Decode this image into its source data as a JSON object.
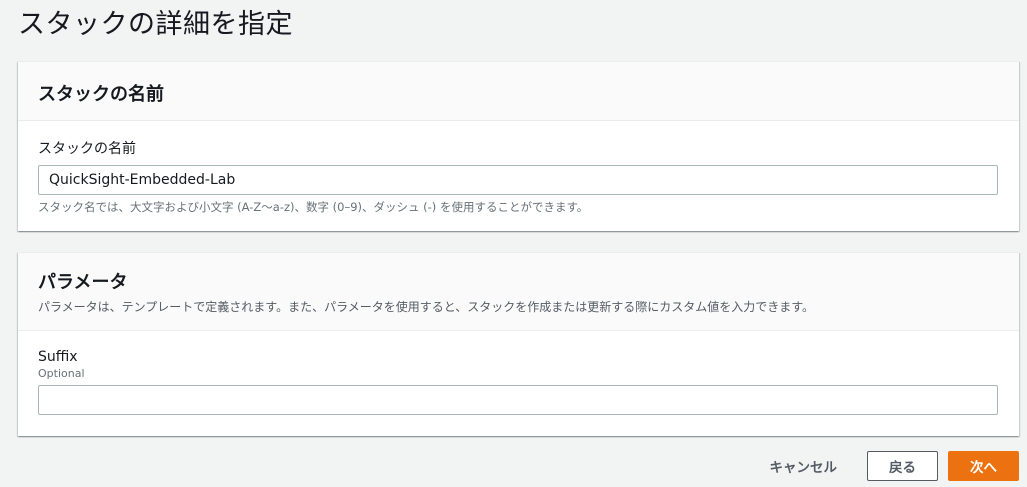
{
  "page": {
    "title": "スタックの詳細を指定"
  },
  "stack_name_panel": {
    "heading": "スタックの名前",
    "field_label": "スタックの名前",
    "field_value": "QuickSight-Embedded-Lab",
    "hint": "スタック名では、大文字および小文字 (A-Z〜a-z)、数字 (0–9)、ダッシュ (-) を使用することができます。"
  },
  "parameters_panel": {
    "heading": "パラメータ",
    "description": "パラメータは、テンプレートで定義されます。また、パラメータを使用すると、スタックを作成または更新する際にカスタム値を入力できます。",
    "suffix_label": "Suffix",
    "suffix_sublabel": "Optional",
    "suffix_value": ""
  },
  "footer": {
    "cancel_label": "キャンセル",
    "back_label": "戻る",
    "next_label": "次へ"
  },
  "colors": {
    "primary": "#ec7211",
    "background": "#f2f3f3",
    "text": "#16191f"
  }
}
